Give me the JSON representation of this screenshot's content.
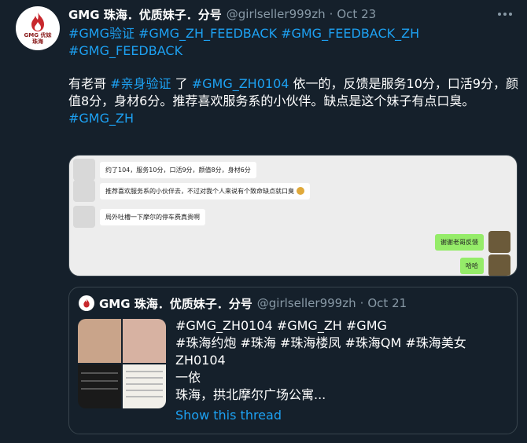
{
  "tweet": {
    "author_name": "GMG 珠海．优质妹子．分号",
    "handle": "@girlseller999zh",
    "separator": "·",
    "time": "Oct 23",
    "avatar_text": [
      "GMG 优妹",
      "珠海"
    ],
    "hashtags": [
      "#GMG验证",
      "#GMG_ZH_FEEDBACK",
      "#GMG_FEEDBACK_ZH",
      "#GMG_FEEDBACK"
    ],
    "body": {
      "part1": "有老哥 ",
      "tag1": "#亲身验证",
      "part2": " 了 ",
      "tag2": "#GMG_ZH0104",
      "part3": " 依一的，反馈是服务10分，口活9分，颜值8分，身材6分。推荐喜欢服务系的小伙伴。缺点是这个妹子有点口臭。",
      "tag3": "#GMG_ZH"
    }
  },
  "chat": {
    "messages": [
      {
        "side": "left",
        "text": "约了104，服务10分，口活9分，颜值8分，身材6分"
      },
      {
        "side": "left",
        "text": "推荐喜欢服务系的小伙伴去，不过对我个人来说有个致命缺点就口臭"
      },
      {
        "side": "left",
        "text": "局外吐槽一下摩尔的停车费真贵啊"
      },
      {
        "side": "right",
        "text": "谢谢老哥反馈"
      },
      {
        "side": "right",
        "text": "哈哈"
      }
    ]
  },
  "quote": {
    "author_name": "GMG 珠海．优质妹子．分号",
    "handle": "@girlseller999zh",
    "separator": "·",
    "time": "Oct 21",
    "lines": [
      "#GMG_ZH0104 #GMG_ZH #GMG",
      "#珠海约炮 #珠海 #珠海楼凤 #珠海QM #珠海美女",
      "ZH0104",
      "一依",
      "珠海，拱北摩尔广场公寓..."
    ],
    "show_thread": "Show this thread"
  },
  "colors": {
    "background": "#15202b",
    "link": "#1da1f2",
    "muted": "#8899a6",
    "border": "#38444d"
  }
}
